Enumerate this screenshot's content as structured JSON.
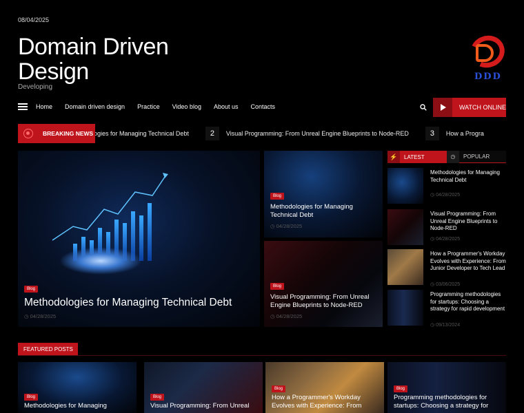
{
  "header": {
    "date": "08/04/2025",
    "site_title": "Domain Driven Design",
    "tagline": "Developing",
    "logo_text": "DDD"
  },
  "nav": {
    "items": [
      "Home",
      "Domain driven design",
      "Practice",
      "Video blog",
      "About us",
      "Contacts"
    ],
    "watch_label": "WATCH ONLINE"
  },
  "breaking": {
    "label": "BREAKING NEWS",
    "items": [
      {
        "num": "",
        "text": "logies for Managing Technical Debt"
      },
      {
        "num": "2",
        "text": "Visual Programming: From Unreal Engine Blueprints to Node-RED"
      },
      {
        "num": "3",
        "text": "How a Progra"
      }
    ]
  },
  "hero": {
    "tag": "Blog",
    "title": "Methodologies for Managing Technical Debt",
    "date": "04/28/2025"
  },
  "cards": [
    {
      "tag": "Blog",
      "title": "Methodologies for Managing Technical Debt",
      "date": "04/28/2025"
    },
    {
      "tag": "Blog",
      "title": "Visual Programming: From Unreal Engine Blueprints to Node-RED",
      "date": "04/28/2025"
    }
  ],
  "sidebar": {
    "tab_latest": "LATEST",
    "tab_popular": "POPULAR",
    "items": [
      {
        "title": "Methodologies for Managing Technical Debt",
        "date": "04/28/2025"
      },
      {
        "title": "Visual Programming: From Unreal Engine Blueprints to Node-RED",
        "date": "04/28/2025"
      },
      {
        "title": "How a Programmer's Workday Evolves with Experience: From Junior Developer to Tech Lead",
        "date": "03/06/2025"
      },
      {
        "title": "Programming methodologies for startups: Choosing a strategy for rapid development",
        "date": "09/13/2024"
      }
    ]
  },
  "featured": {
    "label": "FEATURED POSTS",
    "items": [
      {
        "tag": "Blog",
        "title": "Methodologies for Managing"
      },
      {
        "tag": "Blog",
        "title": "Visual Programming: From Unreal"
      },
      {
        "tag": "Blog",
        "title": "How a Programmer's Workday Evolves with Experience: From"
      },
      {
        "tag": "Blog",
        "title": "Programming methodologies for startups: Choosing a strategy for"
      }
    ]
  },
  "colors": {
    "accent": "#c0141c",
    "background": "#000000"
  }
}
